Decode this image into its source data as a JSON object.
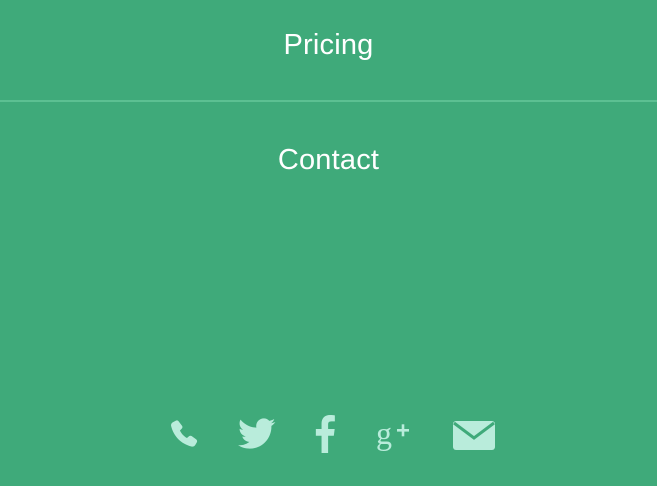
{
  "menu": {
    "items": [
      {
        "label": "Pricing"
      },
      {
        "label": "Contact"
      }
    ]
  },
  "social": {
    "icon_color": "#b9ecdb",
    "icons": [
      "phone-icon",
      "twitter-icon",
      "facebook-icon",
      "google-plus-icon",
      "mail-icon"
    ],
    "gplus_glyph": "g+"
  },
  "colors": {
    "background": "#3faa7a",
    "divider": "#5cc092",
    "text": "#ffffff"
  }
}
